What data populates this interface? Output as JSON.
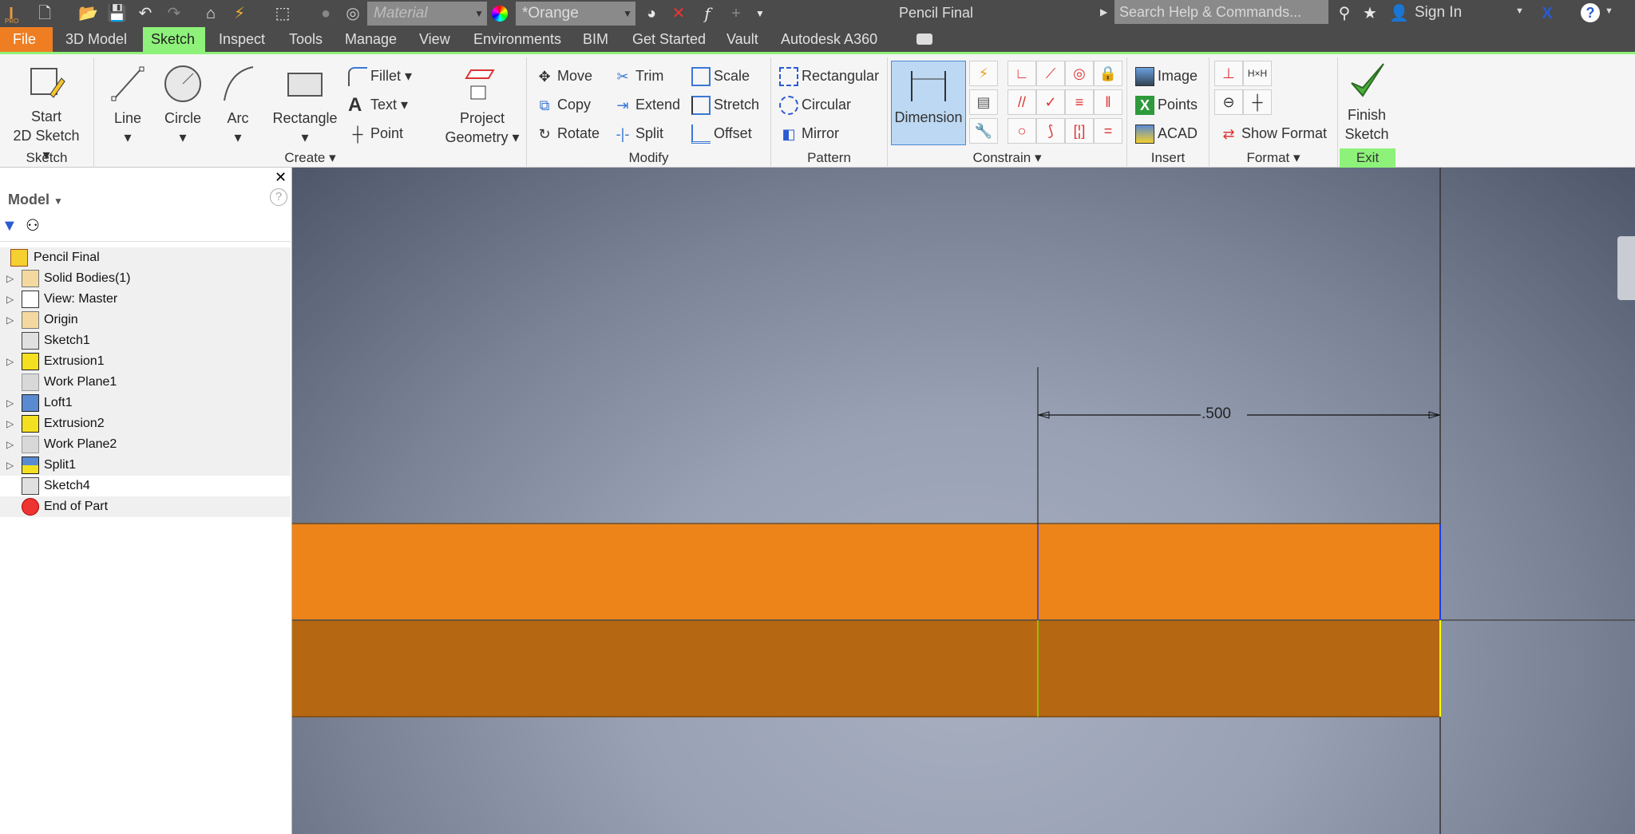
{
  "titlebar": {
    "material_placeholder": "Material",
    "appearance": "*Orange",
    "document_title": "Pencil Final",
    "search_placeholder": "Search Help & Commands...",
    "sign_in": "Sign In",
    "help": "?",
    "pro_badge": "PRO"
  },
  "tabs": [
    {
      "label": "File"
    },
    {
      "label": "3D Model"
    },
    {
      "label": "Sketch",
      "active": true
    },
    {
      "label": "Inspect"
    },
    {
      "label": "Tools"
    },
    {
      "label": "Manage"
    },
    {
      "label": "View"
    },
    {
      "label": "Environments"
    },
    {
      "label": "BIM"
    },
    {
      "label": "Get Started"
    },
    {
      "label": "Vault"
    },
    {
      "label": "Autodesk A360"
    }
  ],
  "ribbon": {
    "sketch": {
      "label": "Sketch",
      "start_line1": "Start",
      "start_line2": "2D Sketch"
    },
    "create": {
      "label": "Create",
      "line": "Line",
      "circle": "Circle",
      "arc": "Arc",
      "rectangle": "Rectangle",
      "fillet": "Fillet",
      "text": "Text",
      "point": "Point",
      "project_line1": "Project",
      "project_line2": "Geometry"
    },
    "modify": {
      "label": "Modify",
      "move": "Move",
      "trim": "Trim",
      "scale": "Scale",
      "copy": "Copy",
      "extend": "Extend",
      "stretch": "Stretch",
      "rotate": "Rotate",
      "split": "Split",
      "offset": "Offset"
    },
    "pattern": {
      "label": "Pattern",
      "rectangular": "Rectangular",
      "circular": "Circular",
      "mirror": "Mirror"
    },
    "constrain": {
      "label": "Constrain",
      "dimension": "Dimension"
    },
    "insert": {
      "label": "Insert",
      "image": "Image",
      "points": "Points",
      "acad": "ACAD"
    },
    "format": {
      "label": "Format",
      "show_format": "Show Format"
    },
    "exit": {
      "label": "Exit",
      "finish_line1": "Finish",
      "finish_line2": "Sketch"
    }
  },
  "browser": {
    "title": "Model",
    "help": "?",
    "items": [
      {
        "label": "Pencil Final",
        "icon": "part-icon",
        "expandable": false
      },
      {
        "label": "Solid Bodies(1)",
        "icon": "folder-icon",
        "expandable": true
      },
      {
        "label": "View: Master",
        "icon": "view-icon",
        "expandable": true
      },
      {
        "label": "Origin",
        "icon": "folder-icon",
        "expandable": true
      },
      {
        "label": "Sketch1",
        "icon": "sketch-icon",
        "expandable": false
      },
      {
        "label": "Extrusion1",
        "icon": "extrusion-icon",
        "expandable": true
      },
      {
        "label": "Work Plane1",
        "icon": "work-plane-icon",
        "expandable": false
      },
      {
        "label": "Loft1",
        "icon": "loft-icon",
        "expandable": true
      },
      {
        "label": "Extrusion2",
        "icon": "extrusion-icon",
        "expandable": true
      },
      {
        "label": "Work Plane2",
        "icon": "work-plane-icon",
        "expandable": true
      },
      {
        "label": "Split1",
        "icon": "split-icon",
        "expandable": true
      },
      {
        "label": "Sketch4",
        "icon": "sketch-icon",
        "expandable": false,
        "active": true
      },
      {
        "label": "End of Part",
        "icon": "end-of-part-icon",
        "expandable": false
      }
    ]
  },
  "canvas": {
    "dimension_value": ".500",
    "colors": {
      "body_top": "#ed8419",
      "body_bottom": "#b66712",
      "sketch_line": "#1a3cff",
      "constraint_line": "#ffff00",
      "fixed_line": "#88dd00"
    }
  }
}
